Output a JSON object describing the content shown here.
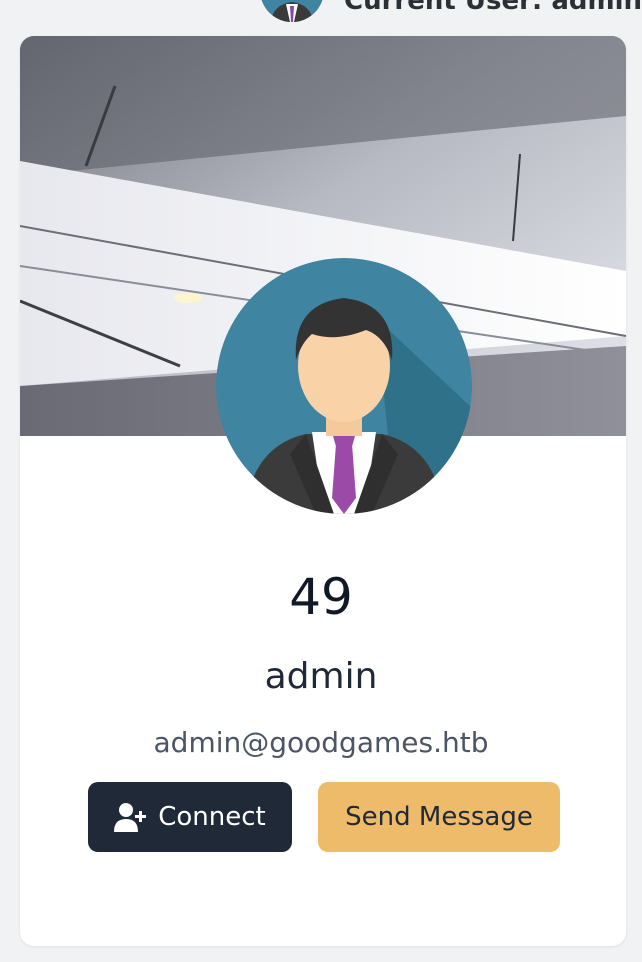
{
  "header": {
    "user_label": "Current User: admin",
    "icons": [
      "bell-icon",
      "user-avatar"
    ]
  },
  "profile": {
    "stat_value": "49",
    "username": "admin",
    "email": "admin@goodgames.htb",
    "cover": "ceiling-cover-image",
    "avatar": "businessman-avatar"
  },
  "actions": {
    "connect_label": "Connect",
    "connect_icon": "user-plus-icon",
    "message_label": "Send Message"
  },
  "colors": {
    "primary_button": "#1f2937",
    "accent_button": "#eebb6b",
    "avatar_bg": "#3f84a0"
  }
}
